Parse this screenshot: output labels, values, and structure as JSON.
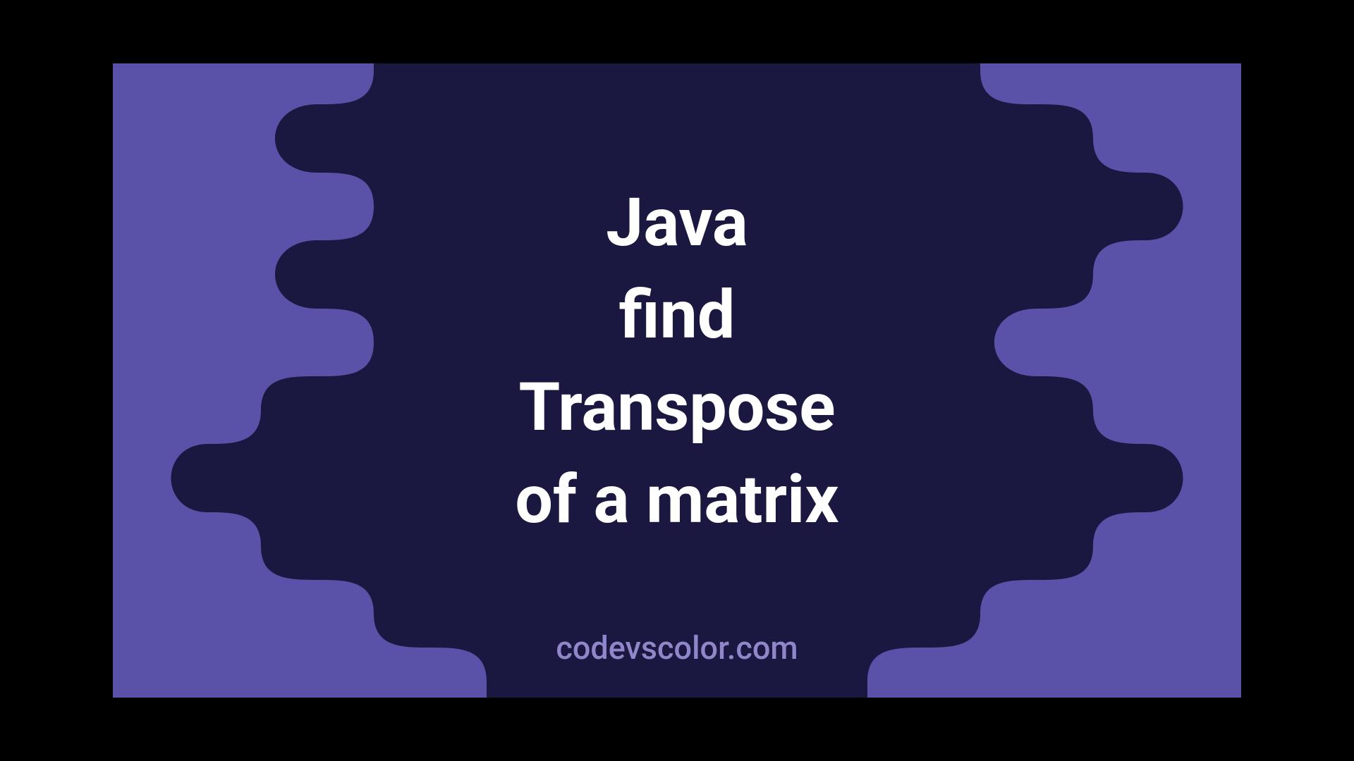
{
  "title": {
    "line1": "Java",
    "line2": "find",
    "line3": "Transpose",
    "line4": "of a matrix"
  },
  "footer": {
    "brand": "codevscolor.com"
  },
  "colors": {
    "background": "#5a52a8",
    "blob": "#1a1840",
    "text": "#ffffff",
    "brand": "#8f87c9"
  }
}
